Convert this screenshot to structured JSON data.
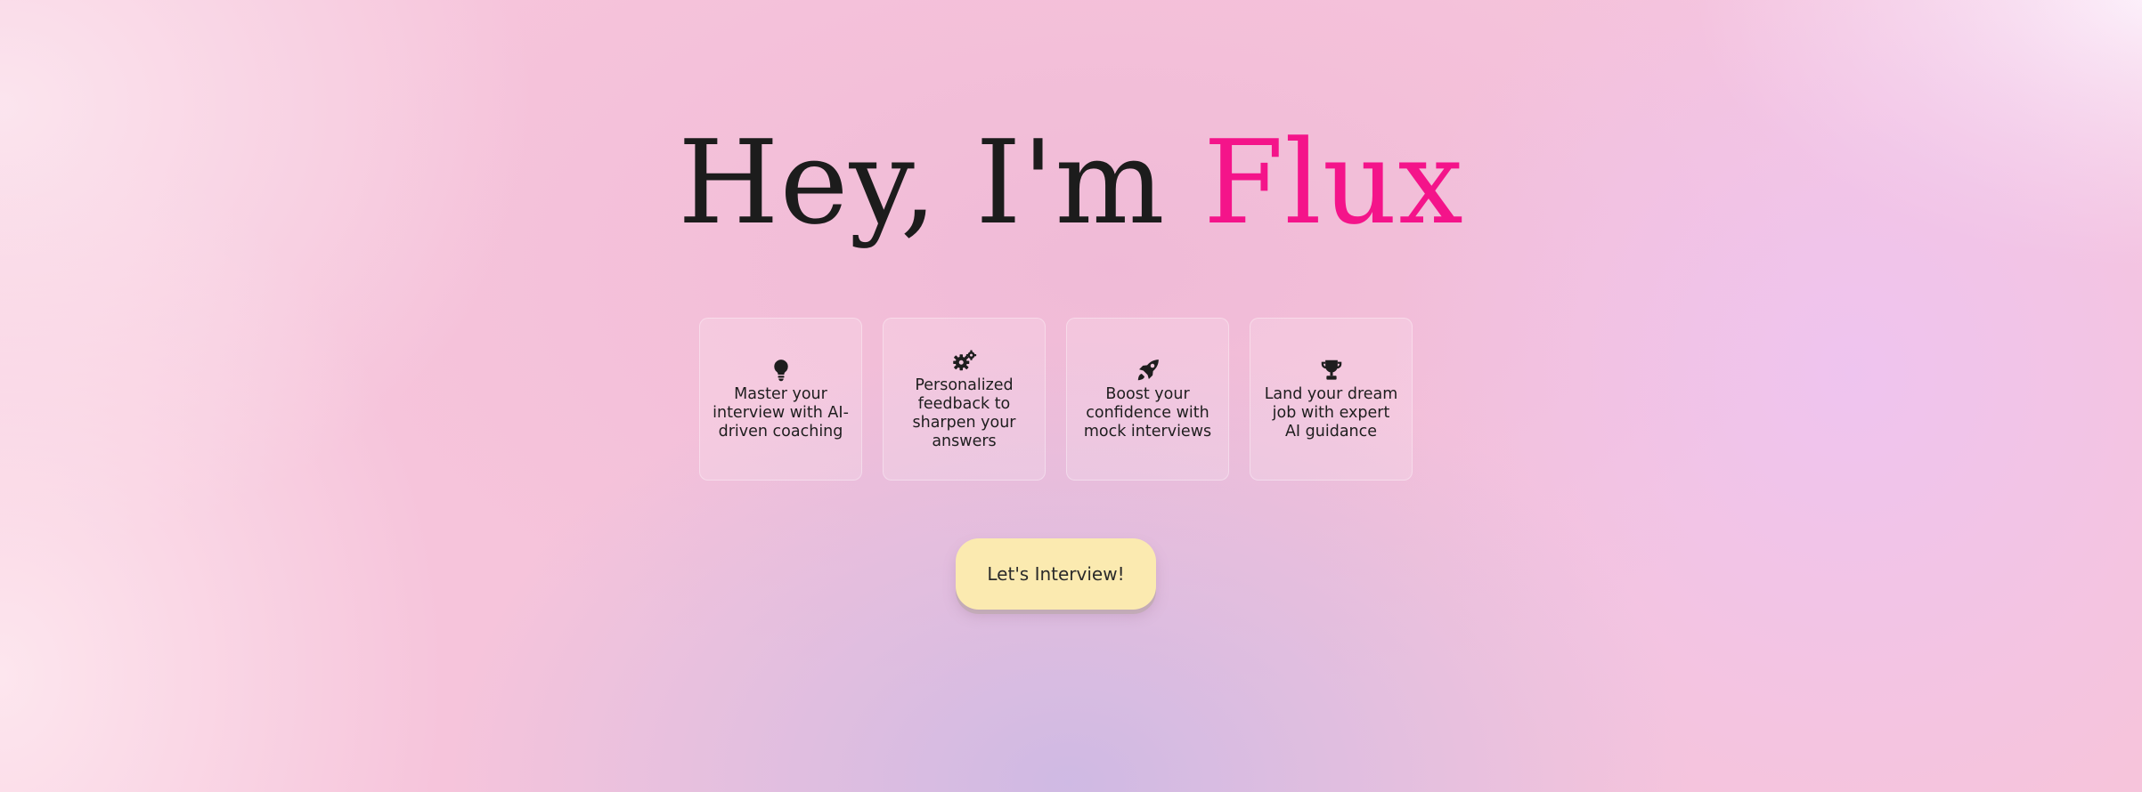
{
  "hero": {
    "title_prefix": "Hey, I'm ",
    "title_accent": "Flux",
    "accent_color": "#f4148a"
  },
  "features": [
    {
      "icon": "lightbulb-icon",
      "text": "Master your interview with AI-driven coaching"
    },
    {
      "icon": "gears-icon",
      "text": "Personalized feedback to sharpen your answers"
    },
    {
      "icon": "rocket-icon",
      "text": "Boost your confidence with mock interviews"
    },
    {
      "icon": "trophy-icon",
      "text": "Land your dream job with expert AI guidance"
    }
  ],
  "cta": {
    "label": "Let's Interview!",
    "color": "#fbeab0"
  }
}
